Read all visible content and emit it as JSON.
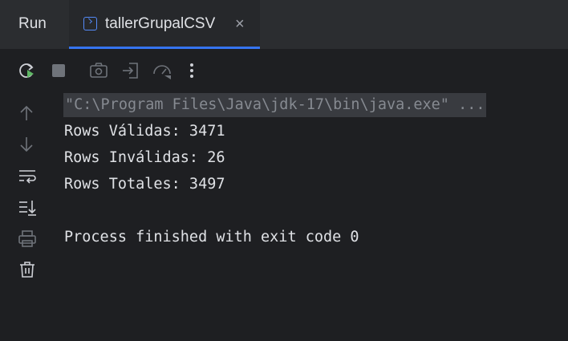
{
  "tabbar": {
    "run_label": "Run",
    "tab": {
      "label": "tallerGrupalCSV",
      "close": "×"
    }
  },
  "console": {
    "command": "\"C:\\Program Files\\Java\\jdk-17\\bin\\java.exe\" ...",
    "lines": [
      "Rows Válidas: 3471",
      "Rows Inválidas: 26",
      "Rows Totales: 3497",
      "Process finished with exit code 0"
    ]
  },
  "toolbar": {
    "icons": [
      "rerun-icon",
      "stop-icon",
      "camera-icon",
      "exit-import-icon",
      "profiler-icon",
      "more-icon"
    ],
    "side_icons": [
      "up-arrow-icon",
      "down-arrow-icon",
      "soft-wrap-icon",
      "scroll-to-end-icon",
      "print-icon",
      "trash-icon"
    ]
  },
  "colors": {
    "accent": "#3574f0",
    "background": "#1e1f22",
    "tabbar": "#2b2d30"
  }
}
